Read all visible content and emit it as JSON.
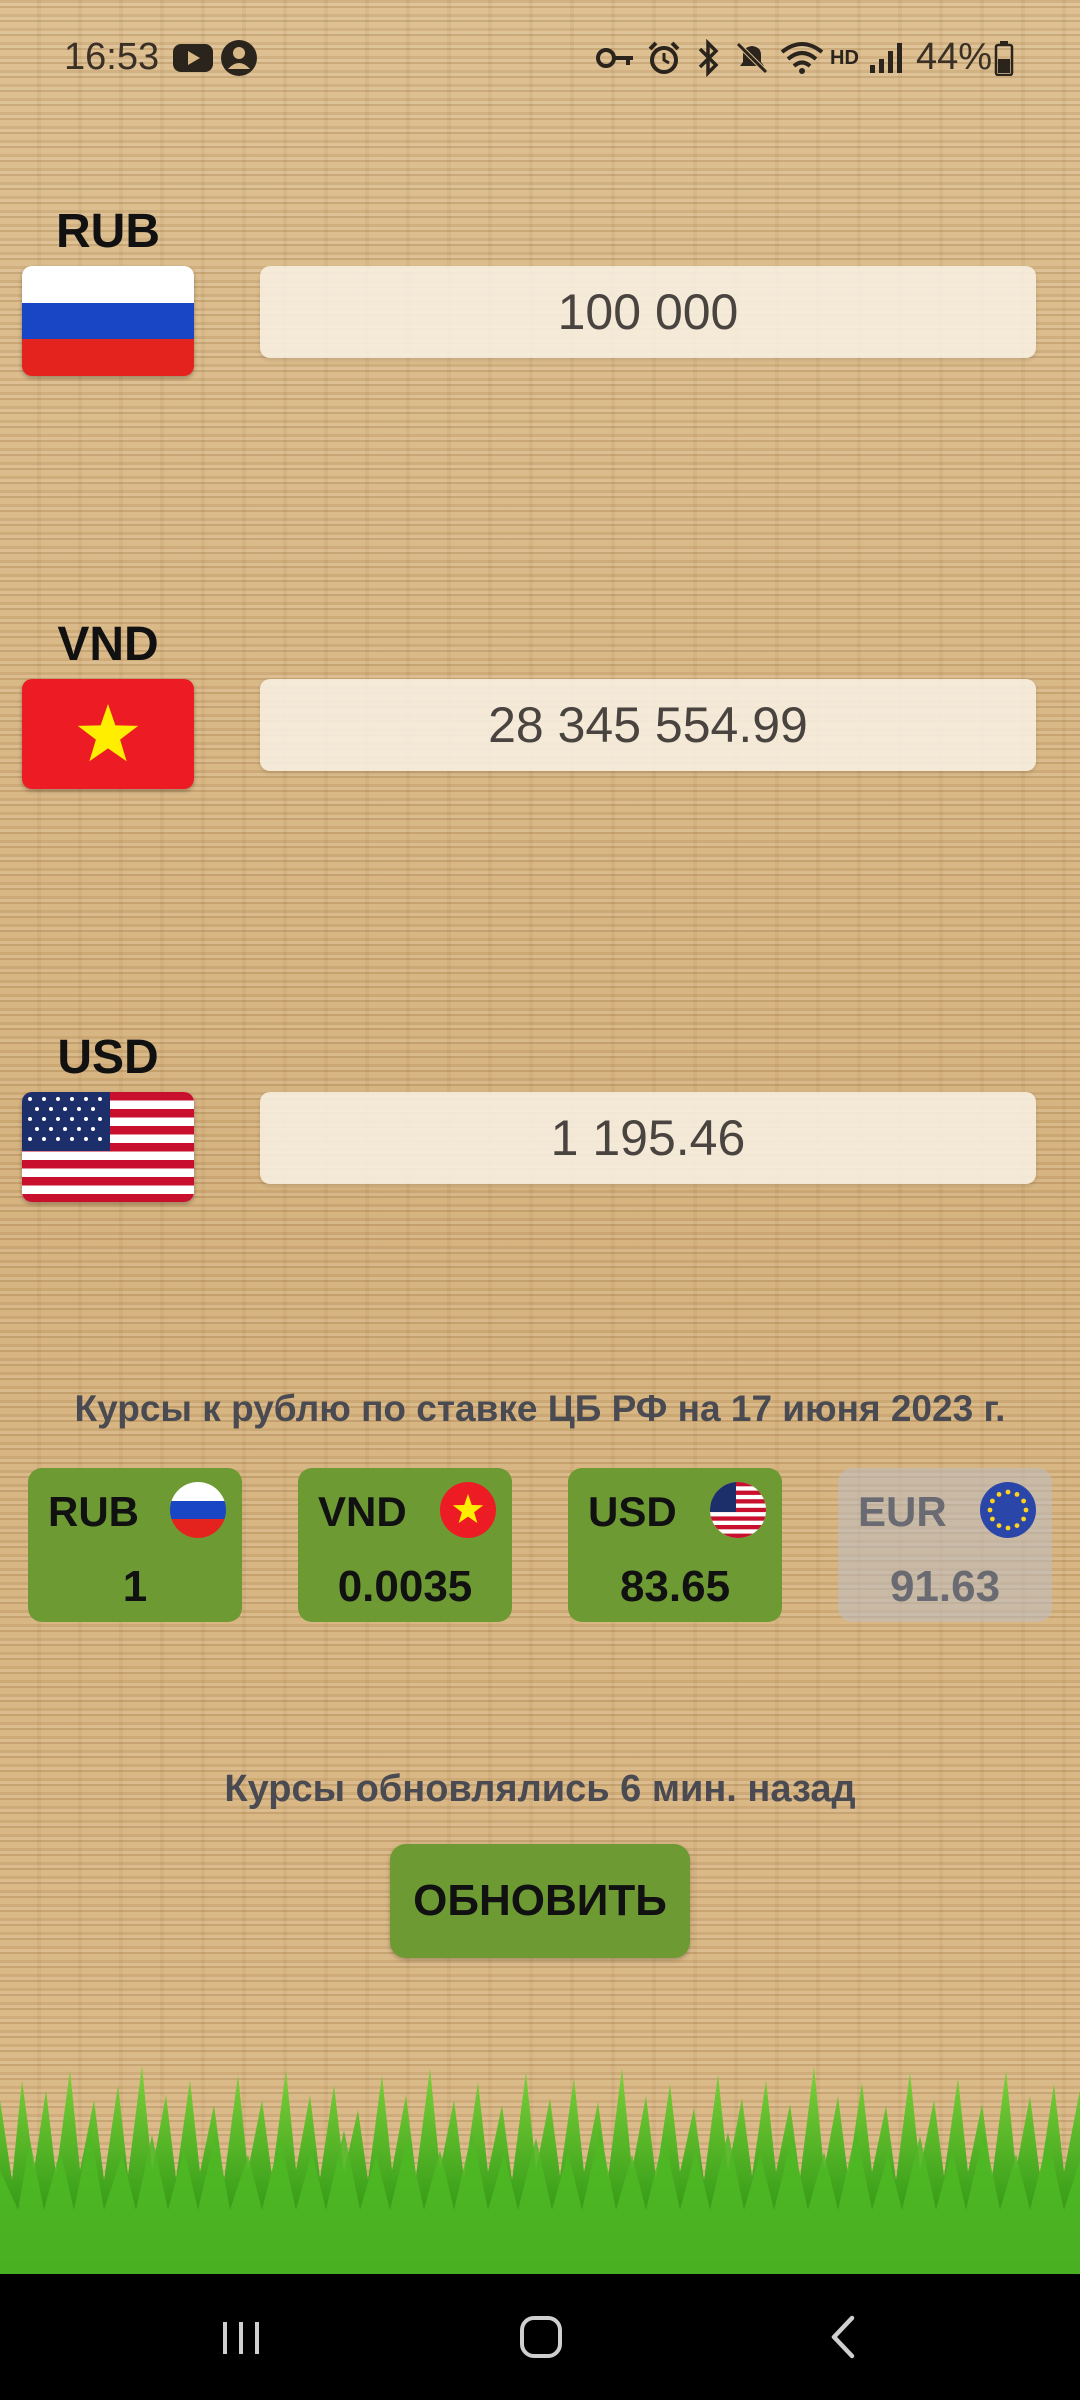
{
  "status_bar": {
    "time": "16:53",
    "battery": "44%",
    "icons": [
      "youtube-icon",
      "account-icon",
      "vpn-key-icon",
      "alarm-icon",
      "bluetooth-icon",
      "mute-icon",
      "wifi-icon",
      "hd-icon",
      "signal-icon",
      "battery-icon"
    ]
  },
  "converter": {
    "rows": [
      {
        "code": "RUB",
        "value": "100 000",
        "flag": "russia-flag"
      },
      {
        "code": "VND",
        "value": "28 345 554.99",
        "flag": "vietnam-flag"
      },
      {
        "code": "USD",
        "value": "1 195.46",
        "flag": "usa-flag"
      }
    ]
  },
  "rates": {
    "caption": "Курсы к рублю по ставке ЦБ РФ на 17 июня 2023 г.",
    "cards": [
      {
        "code": "RUB",
        "value": "1",
        "active": true
      },
      {
        "code": "VND",
        "value": "0.0035",
        "active": true
      },
      {
        "code": "USD",
        "value": "83.65",
        "active": true
      },
      {
        "code": "EUR",
        "value": "91.63",
        "active": false
      }
    ]
  },
  "footer": {
    "updated_text": "Курсы обновлялись 6 мин. назад",
    "refresh_label": "ОБНОВИТЬ"
  },
  "colors": {
    "card_green": "#6e9a34",
    "card_disabled": "#c4c2c2",
    "wood": "#d9b887"
  }
}
